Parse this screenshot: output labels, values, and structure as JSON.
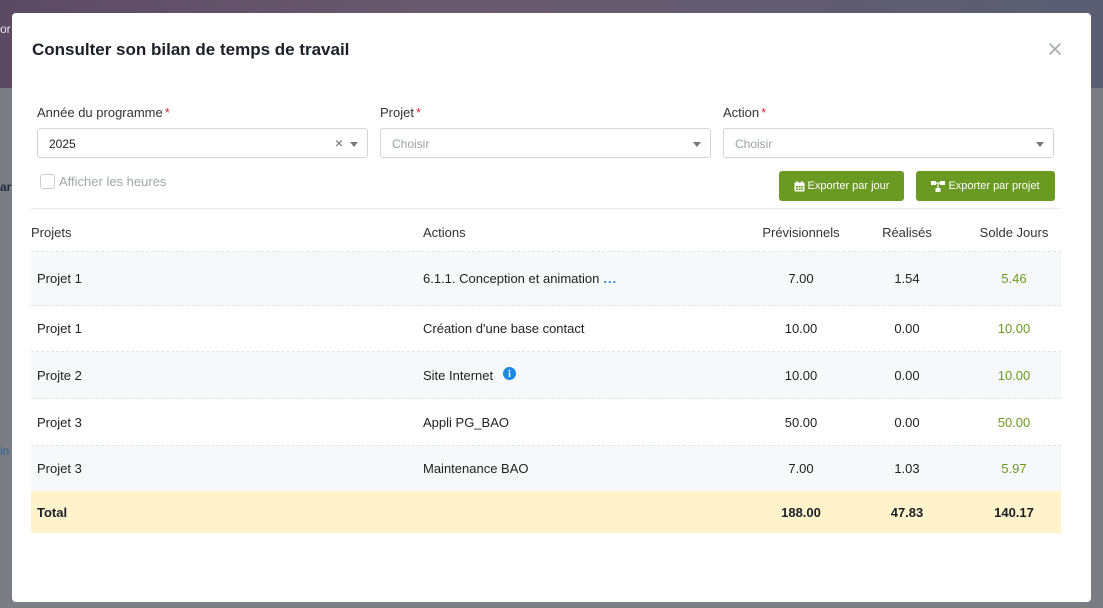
{
  "modal": {
    "title": "Consulter son bilan de temps de travail"
  },
  "filters": {
    "year": {
      "label": "Année du programme",
      "value": "2025"
    },
    "project": {
      "label": "Projet",
      "placeholder": "Choisir"
    },
    "action": {
      "label": "Action",
      "placeholder": "Choisir"
    },
    "required_marker": "*",
    "show_hours_label": "Afficher les heures"
  },
  "buttons": {
    "export_by_day": "Exporter par jour",
    "export_by_project": "Exporter par projet"
  },
  "table": {
    "headers": {
      "projects": "Projets",
      "actions": "Actions",
      "forecast": "Prévisionnels",
      "done": "Réalisés",
      "balance": "Solde Jours"
    },
    "rows": [
      {
        "project": "Projet 1",
        "action": "6.1.1. Conception et animation",
        "more": "...",
        "forecast": "7.00",
        "done": "1.54",
        "balance": "5.46"
      },
      {
        "project": "Projet 1",
        "action": "Création d'une base contact",
        "forecast": "10.00",
        "done": "0.00",
        "balance": "10.00"
      },
      {
        "project": "Projte 2",
        "action": "Site Internet",
        "forecast": "10.00",
        "done": "0.00",
        "balance": "10.00"
      },
      {
        "project": "Projet 3",
        "action": "Appli PG_BAO",
        "forecast": "50.00",
        "done": "0.00",
        "balance": "50.00"
      },
      {
        "project": "Projet 3",
        "action": "Maintenance BAO",
        "forecast": "7.00",
        "done": "1.03",
        "balance": "5.97"
      }
    ],
    "total": {
      "label": "Total",
      "forecast": "188.00",
      "done": "47.83",
      "balance": "140.17"
    }
  },
  "background": {
    "frag1": "or",
    "frag2": "ar",
    "frag3": "in"
  },
  "colors": {
    "accent": "#6b9a23",
    "balance_text": "#6a9a23",
    "total_bg": "#fff3cc",
    "required": "#e0243a",
    "info": "#1e88e5"
  },
  "icons": {
    "close": "close-icon",
    "calendar": "calendar-icon",
    "sitemap": "sitemap-icon",
    "info": "info-icon",
    "dropdown": "chevron-down-icon",
    "clear": "clear-icon"
  }
}
